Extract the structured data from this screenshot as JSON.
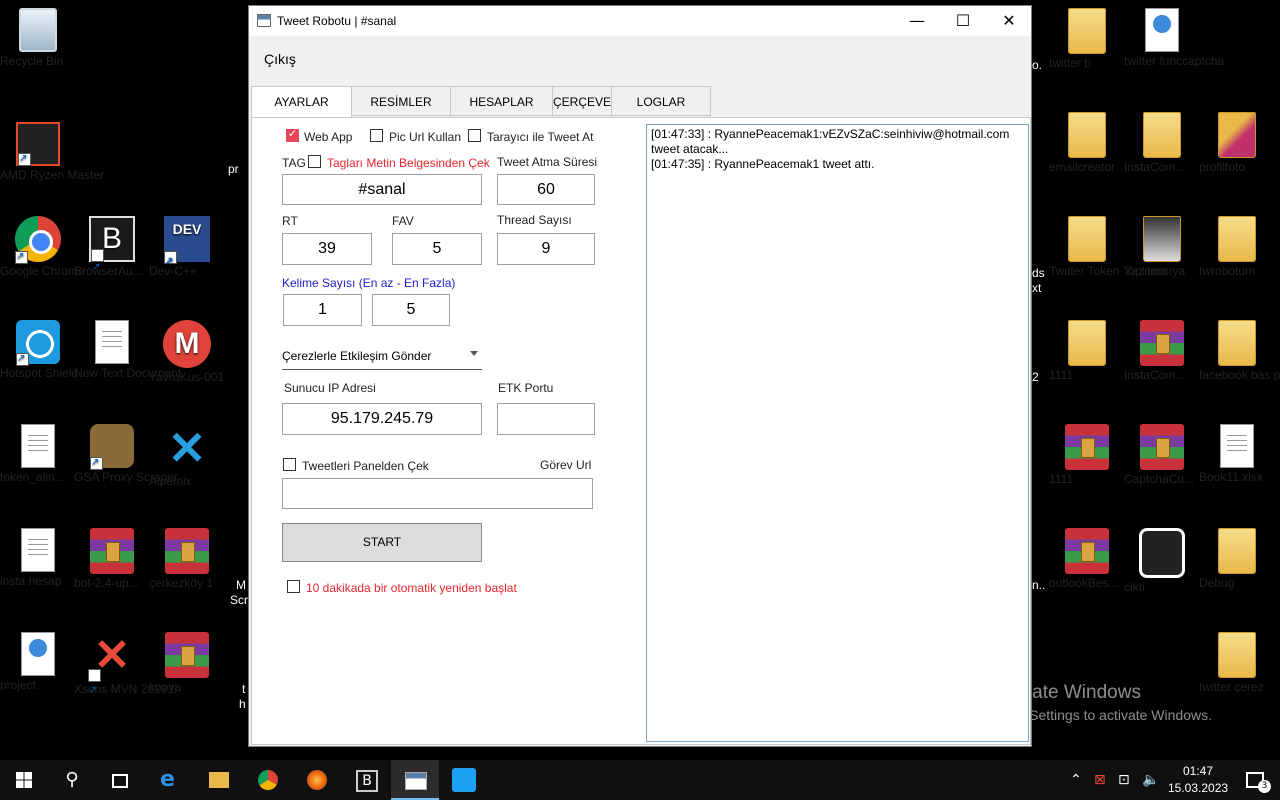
{
  "desktop": {
    "icons": [
      {
        "label": "Recycle Bin"
      },
      {
        "label": "AMD Ryzen Master"
      },
      {
        "label": "Google Chrome"
      },
      {
        "label": "BrowserAu..."
      },
      {
        "label": "Dev-C++"
      },
      {
        "label": "Hotspot Shield"
      },
      {
        "label": "New Text Document"
      },
      {
        "label": "YavruKus-001"
      },
      {
        "label": "token_alin..."
      },
      {
        "label": "GSA Proxy Scraper"
      },
      {
        "label": "Alpemix"
      },
      {
        "label": "insta hesap"
      },
      {
        "label": "bot-2.4-up..."
      },
      {
        "label": "çerkezköy 1"
      },
      {
        "label": "project"
      },
      {
        "label": "Xsens MVN 2023.0"
      },
      {
        "label": "kopya"
      },
      {
        "label": "twitter b"
      },
      {
        "label": "twitter funccaptcha"
      },
      {
        "label": "emailcreator"
      },
      {
        "label": "InstaCom..."
      },
      {
        "label": "profilfoto"
      },
      {
        "label": "Twitter Token Toplama"
      },
      {
        "label": "Yazılımcıya"
      },
      {
        "label": "twrobotum"
      },
      {
        "label": "1111"
      },
      {
        "label": "InstaCom..."
      },
      {
        "label": "facebook bas project"
      },
      {
        "label": "1111"
      },
      {
        "label": "CaptchaCu..."
      },
      {
        "label": "Book11.xlsx"
      },
      {
        "label": "outlookBes..."
      },
      {
        "label": "cikti"
      },
      {
        "label": "Debug"
      },
      {
        "label": "twitter çerez"
      }
    ],
    "partial_labels": [
      "pr",
      "M",
      "Scr",
      "t",
      "h",
      "o.",
      "ds",
      "xt",
      "2",
      "n.."
    ],
    "watermark": {
      "title": "Activate Windows",
      "subtitle": "Go to Settings to activate Windows."
    }
  },
  "window": {
    "title": "Tweet Robotu | #sanal",
    "controls": {
      "minimize": "—",
      "maximize": "☐",
      "close": "✕"
    },
    "menu": {
      "exit": "Çıkış"
    },
    "tabs": [
      {
        "label": "AYARLAR",
        "active": true
      },
      {
        "label": "RESİMLER"
      },
      {
        "label": "HESAPLAR"
      },
      {
        "label": "ÇERÇEVE"
      },
      {
        "label": "LOGLAR"
      }
    ],
    "settings": {
      "web_app": {
        "label": "Web App",
        "checked": true
      },
      "pic_url": {
        "label": "Pic Url Kullan",
        "checked": false
      },
      "browser_tweet": {
        "label": "Tarayıcı ile Tweet At",
        "checked": false
      },
      "tag_label": "TAG",
      "tag_from_file": {
        "label": "Tagları Metin Belgesinden Çek",
        "checked": false
      },
      "tag_value": "#sanal",
      "tweet_interval_label": "Tweet Atma Süresi",
      "tweet_interval_value": "60",
      "rt_label": "RT",
      "rt_value": "39",
      "fav_label": "FAV",
      "fav_value": "5",
      "thread_label": "Thread Sayısı",
      "thread_value": "9",
      "word_count_label": "Kelime Sayısı (En az - En Fazla)",
      "word_min": "1",
      "word_max": "5",
      "cookie_combo": "Çerezlerle Etkileşim Gönder",
      "server_ip_label": "Sunucu IP Adresi",
      "server_ip_value": "95.179.245.79",
      "etk_port_label": "ETK Portu",
      "etk_port_value": "",
      "pull_tweets": {
        "label": "Tweetleri Panelden Çek",
        "checked": false
      },
      "task_url_label": "Görev Url",
      "task_url_value": "",
      "start_label": "START",
      "auto_restart": {
        "label": "10 dakikada bir otomatik yeniden başlat",
        "checked": false
      }
    },
    "log": [
      "[01:47:33] : RyannePeacemak1:vEZvSZaC:seinhiviw@hotmail.com tweet atacak...",
      "[01:47:35] : RyannePeacemak1 tweet attı."
    ]
  },
  "taskbar": {
    "time": "01:47",
    "date": "15.03.2023",
    "notifications": "3"
  }
}
